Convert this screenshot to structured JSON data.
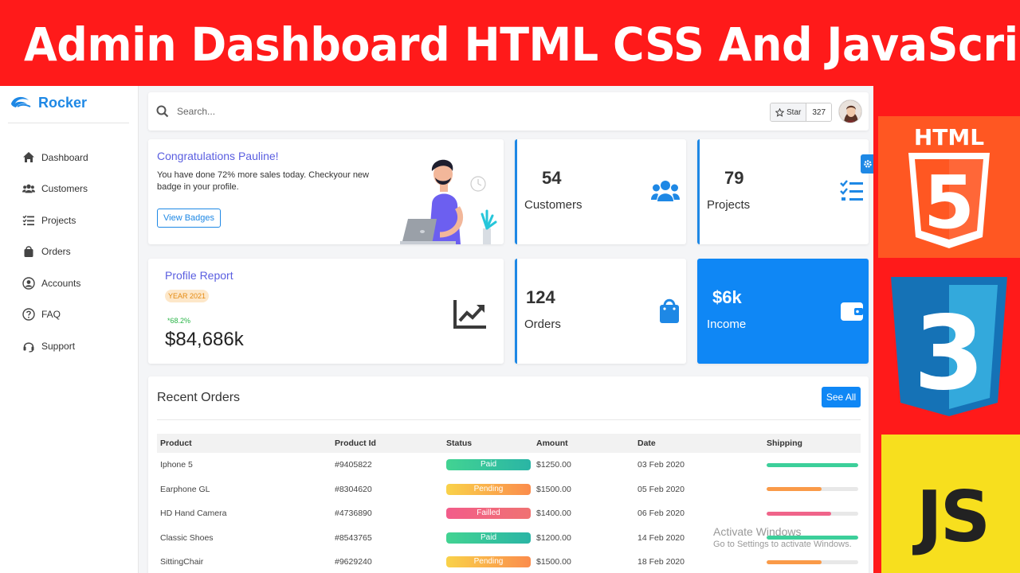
{
  "banner": {
    "title": "Admin Dashboard HTML CSS And JavaScript"
  },
  "brand": {
    "name": "Rocker"
  },
  "sidebar": {
    "items": [
      {
        "label": "Dashboard",
        "icon": "home-icon"
      },
      {
        "label": "Customers",
        "icon": "users-icon"
      },
      {
        "label": "Projects",
        "icon": "tasks-icon"
      },
      {
        "label": "Orders",
        "icon": "bag-icon"
      },
      {
        "label": "Accounts",
        "icon": "user-circle-icon"
      },
      {
        "label": "FAQ",
        "icon": "question-icon"
      },
      {
        "label": "Support",
        "icon": "headset-icon"
      }
    ]
  },
  "topbar": {
    "search_placeholder": "Search...",
    "star_label": "Star",
    "star_count": "327"
  },
  "welcome": {
    "title": "Congratulations Pauline!",
    "text": "You have done 72% more sales today. Checkyour new badge in your profile.",
    "button": "View Badges"
  },
  "stats": [
    {
      "value": "54",
      "label": "Customers",
      "icon": "users-icon"
    },
    {
      "value": "79",
      "label": "Projects",
      "icon": "tasks-icon"
    },
    {
      "value": "124",
      "label": "Orders",
      "icon": "bag-icon"
    },
    {
      "value": "$6k",
      "label": "Income",
      "icon": "wallet-icon"
    }
  ],
  "profile": {
    "title": "Profile Report",
    "badge": "YEAR 2021",
    "growth": "*68.2%",
    "amount": "$84,686k"
  },
  "orders": {
    "title": "Recent Orders",
    "see_all": "See All",
    "columns": [
      "Product",
      "Product Id",
      "Status",
      "Amount",
      "Date",
      "Shipping"
    ],
    "rows": [
      {
        "product": "Iphone 5",
        "id": "#9405822",
        "status": "Paid",
        "amount": "$1250.00",
        "date": "03 Feb 2020",
        "shipping": 1.0,
        "color": "#3ccf9a"
      },
      {
        "product": "Earphone GL",
        "id": "#8304620",
        "status": "Pending",
        "amount": "$1500.00",
        "date": "05 Feb 2020",
        "shipping": 0.6,
        "color": "#fa9a48"
      },
      {
        "product": "HD Hand Camera",
        "id": "#4736890",
        "status": "Failled",
        "amount": "$1400.00",
        "date": "06 Feb 2020",
        "shipping": 0.7,
        "color": "#f0648a"
      },
      {
        "product": "Classic Shoes",
        "id": "#8543765",
        "status": "Paid",
        "amount": "$1200.00",
        "date": "14 Feb 2020",
        "shipping": 1.0,
        "color": "#3ccf9a"
      },
      {
        "product": "SittingChair",
        "id": "#9629240",
        "status": "Pending",
        "amount": "$1500.00",
        "date": "18 Feb 2020",
        "shipping": 0.6,
        "color": "#fa9a48"
      }
    ]
  },
  "watermark": {
    "line1": "Activate Windows",
    "line2": "Go to Settings to activate Windows."
  },
  "logos": {
    "html_label": "HTML",
    "html_number": "5",
    "css_number": "3",
    "js_label": "JS"
  }
}
